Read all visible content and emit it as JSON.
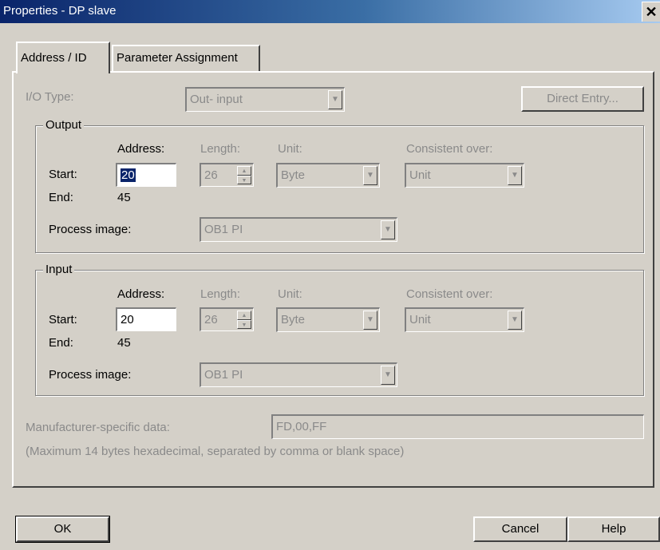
{
  "window": {
    "title": "Properties - DP slave",
    "close_glyph": "✕"
  },
  "tabs": [
    {
      "label": "Address / ID",
      "active": true
    },
    {
      "label": "Parameter Assignment",
      "active": false
    }
  ],
  "io_type": {
    "label": "I/O Type:",
    "value": "Out- input",
    "options_visible": [
      "Out- input"
    ]
  },
  "direct_entry": {
    "label": "Direct Entry..."
  },
  "output": {
    "group_title": "Output",
    "address_header": "Address:",
    "length_header": "Length:",
    "unit_header": "Unit:",
    "consistent_header": "Consistent over:",
    "start_label": "Start:",
    "start_value": "20",
    "length_value": "26",
    "unit_value": "Byte",
    "consistent_value": "Unit",
    "end_label": "End:",
    "end_value": "45",
    "process_image_label": "Process image:",
    "process_image_value": "OB1 PI"
  },
  "input": {
    "group_title": "Input",
    "address_header": "Address:",
    "length_header": "Length:",
    "unit_header": "Unit:",
    "consistent_header": "Consistent over:",
    "start_label": "Start:",
    "start_value": "20",
    "length_value": "26",
    "unit_value": "Byte",
    "consistent_value": "Unit",
    "end_label": "End:",
    "end_value": "45",
    "process_image_label": "Process image:",
    "process_image_value": "OB1 PI"
  },
  "manufacturer": {
    "label": "Manufacturer-specific data:",
    "value": "FD,00,FF",
    "hint": "(Maximum 14 bytes hexadecimal, separated by comma or blank space)"
  },
  "buttons": {
    "ok": "OK",
    "cancel": "Cancel",
    "help": "Help"
  },
  "colors": {
    "face": "#d4d0c8",
    "title_start": "#0a246a",
    "title_end": "#a6caf0",
    "disabled_text": "#8a8a8a"
  }
}
